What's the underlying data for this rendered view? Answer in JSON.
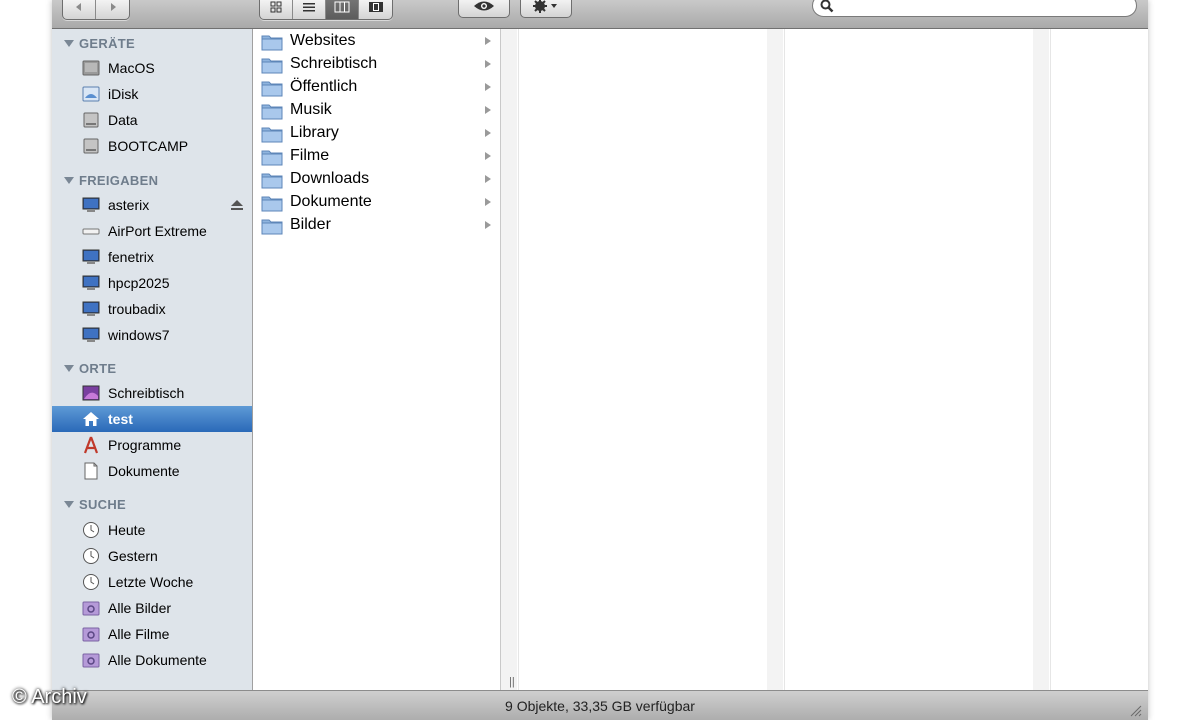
{
  "toolbar": {
    "nav": [
      "back-icon",
      "forward-icon"
    ],
    "views": [
      "icon-view-icon",
      "list-view-icon",
      "column-view-icon",
      "coverflow-view-icon"
    ],
    "active_view": 2,
    "quicklook": "eye-icon",
    "action": "gear-icon",
    "search": {
      "placeholder": "",
      "icon": "search-icon"
    }
  },
  "sidebar": {
    "sections": [
      {
        "title": "GERÄTE",
        "items": [
          {
            "label": "MacOS",
            "icon": "hard-drive-icon"
          },
          {
            "label": "iDisk",
            "icon": "idisk-icon"
          },
          {
            "label": "Data",
            "icon": "hard-drive-icon"
          },
          {
            "label": "BOOTCAMP",
            "icon": "hard-drive-icon"
          }
        ]
      },
      {
        "title": "FREIGABEN",
        "items": [
          {
            "label": "asterix",
            "icon": "network-computer-icon",
            "eject": true
          },
          {
            "label": "AirPort Extreme",
            "icon": "airport-icon"
          },
          {
            "label": "fenetrix",
            "icon": "network-computer-icon"
          },
          {
            "label": "hpcp2025",
            "icon": "network-computer-icon"
          },
          {
            "label": "troubadix",
            "icon": "network-computer-icon"
          },
          {
            "label": "windows7",
            "icon": "network-computer-icon"
          }
        ]
      },
      {
        "title": "ORTE",
        "items": [
          {
            "label": "Schreibtisch",
            "icon": "desktop-icon"
          },
          {
            "label": "test",
            "icon": "home-icon",
            "selected": true
          },
          {
            "label": "Programme",
            "icon": "applications-icon"
          },
          {
            "label": "Dokumente",
            "icon": "document-icon"
          }
        ]
      },
      {
        "title": "SUCHE",
        "items": [
          {
            "label": "Heute",
            "icon": "clock-icon"
          },
          {
            "label": "Gestern",
            "icon": "clock-icon"
          },
          {
            "label": "Letzte Woche",
            "icon": "clock-icon"
          },
          {
            "label": "Alle Bilder",
            "icon": "smart-folder-icon"
          },
          {
            "label": "Alle Filme",
            "icon": "smart-folder-icon"
          },
          {
            "label": "Alle Dokumente",
            "icon": "smart-folder-icon"
          }
        ]
      }
    ]
  },
  "column1": {
    "items": [
      {
        "label": "Websites",
        "icon": "folder-icon"
      },
      {
        "label": "Schreibtisch",
        "icon": "folder-icon"
      },
      {
        "label": "Öffentlich",
        "icon": "folder-icon"
      },
      {
        "label": "Musik",
        "icon": "folder-icon"
      },
      {
        "label": "Library",
        "icon": "folder-icon"
      },
      {
        "label": "Filme",
        "icon": "folder-icon"
      },
      {
        "label": "Downloads",
        "icon": "folder-icon"
      },
      {
        "label": "Dokumente",
        "icon": "folder-icon"
      },
      {
        "label": "Bilder",
        "icon": "folder-icon"
      }
    ]
  },
  "status": {
    "text": "9 Objekte, 33,35 GB verfügbar"
  },
  "watermark": "© Archiv",
  "colors": {
    "selection": "#2a69b8",
    "sidebar_bg": "#dee4ea",
    "section_header": "#6f7d8c"
  }
}
